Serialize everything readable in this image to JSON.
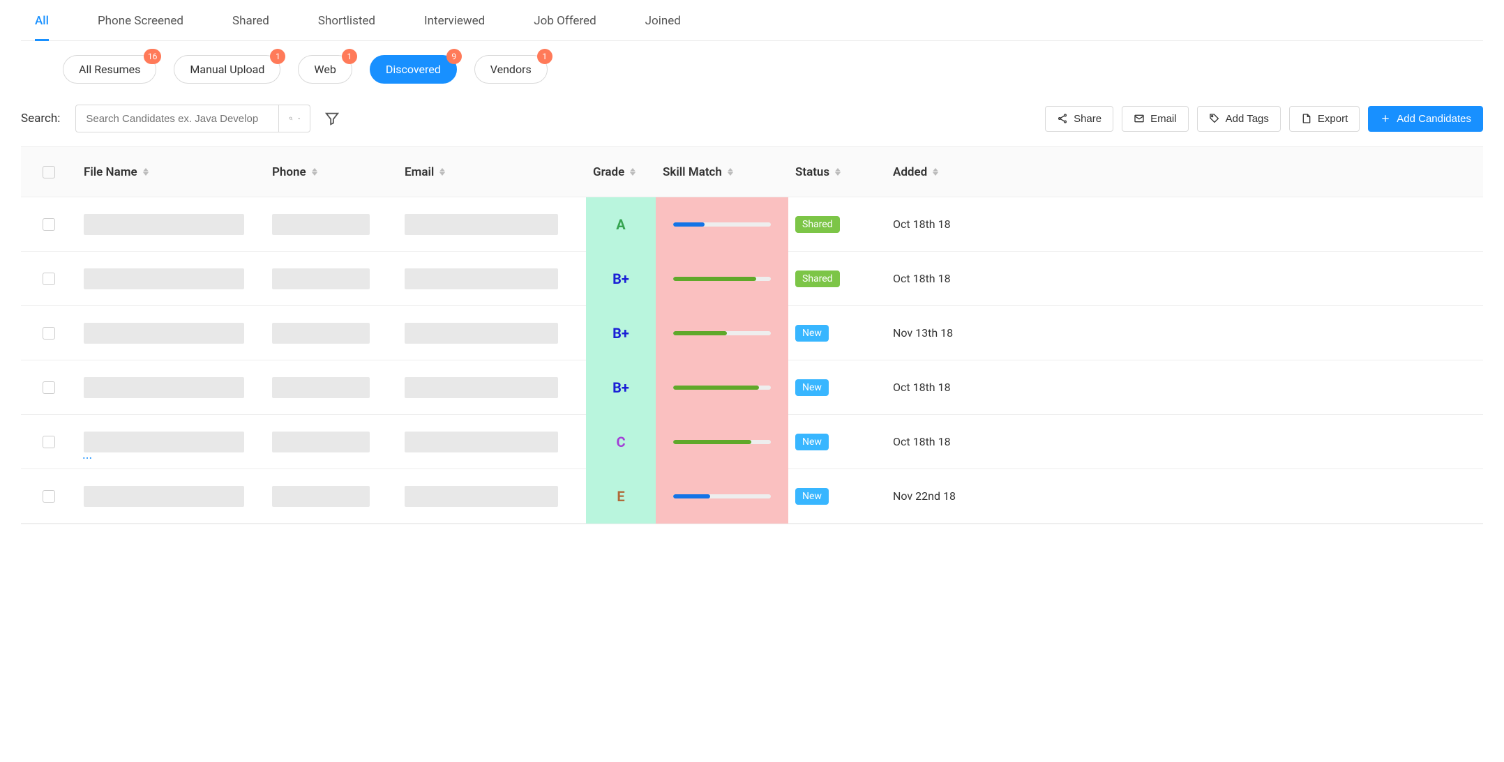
{
  "mainTabs": [
    "All",
    "Phone Screened",
    "Shared",
    "Shortlisted",
    "Interviewed",
    "Job Offered",
    "Joined"
  ],
  "activeMainTab": 0,
  "filterPills": [
    {
      "label": "All Resumes",
      "badge": "16",
      "active": false
    },
    {
      "label": "Manual Upload",
      "badge": "1",
      "active": false
    },
    {
      "label": "Web",
      "badge": "1",
      "active": false
    },
    {
      "label": "Discovered",
      "badge": "9",
      "active": true
    },
    {
      "label": "Vendors",
      "badge": "1",
      "active": false
    }
  ],
  "search": {
    "label": "Search:",
    "placeholder": "Search Candidates ex. Java Develop"
  },
  "actions": {
    "share": "Share",
    "email": "Email",
    "addTags": "Add Tags",
    "export": "Export",
    "addCandidates": "Add Candidates"
  },
  "columns": {
    "fileName": "File Name",
    "phone": "Phone",
    "email": "Email",
    "grade": "Grade",
    "skillMatch": "Skill Match",
    "status": "Status",
    "added": "Added"
  },
  "rows": [
    {
      "grade": "A",
      "gradeColor": "#35a450",
      "skillPct": 32,
      "skillColor": "#1473e6",
      "status": "Shared",
      "statusColor": "#7cc547",
      "added": "Oct 18th 18",
      "ellipsis": false
    },
    {
      "grade": "B+",
      "gradeColor": "#1a20d6",
      "skillPct": 85,
      "skillColor": "#5fa82a",
      "status": "Shared",
      "statusColor": "#7cc547",
      "added": "Oct 18th 18",
      "ellipsis": false
    },
    {
      "grade": "B+",
      "gradeColor": "#1a20d6",
      "skillPct": 55,
      "skillColor": "#5fa82a",
      "status": "New",
      "statusColor": "#38b6ff",
      "added": "Nov 13th 18",
      "ellipsis": false
    },
    {
      "grade": "B+",
      "gradeColor": "#1a20d6",
      "skillPct": 88,
      "skillColor": "#5fa82a",
      "status": "New",
      "statusColor": "#38b6ff",
      "added": "Oct 18th 18",
      "ellipsis": false
    },
    {
      "grade": "C",
      "gradeColor": "#a23fd6",
      "skillPct": 80,
      "skillColor": "#5fa82a",
      "status": "New",
      "statusColor": "#38b6ff",
      "added": "Oct 18th 18",
      "ellipsis": true
    },
    {
      "grade": "E",
      "gradeColor": "#b06a3a",
      "skillPct": 38,
      "skillColor": "#1473e6",
      "status": "New",
      "statusColor": "#38b6ff",
      "added": "Nov 22nd 18",
      "ellipsis": false
    }
  ]
}
